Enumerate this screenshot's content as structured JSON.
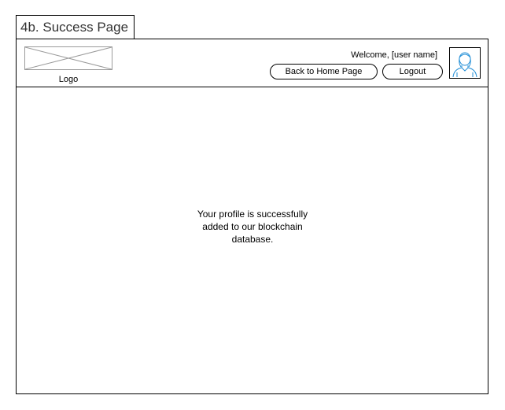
{
  "page_tab": {
    "title": "4b. Success Page"
  },
  "header": {
    "logo_label": "Logo",
    "welcome_text": "Welcome, [user name]",
    "back_button_label": "Back to Home Page",
    "logout_button_label": "Logout",
    "avatar_icon": "user-avatar-icon",
    "logo_placeholder_icon": "image-placeholder-icon"
  },
  "main": {
    "message": "Your profile is successfully\nadded to our blockchain\ndatabase."
  },
  "colors": {
    "border": "#000000",
    "placeholder": "#9a9a9a",
    "avatar_stroke": "#1f8dd6"
  }
}
